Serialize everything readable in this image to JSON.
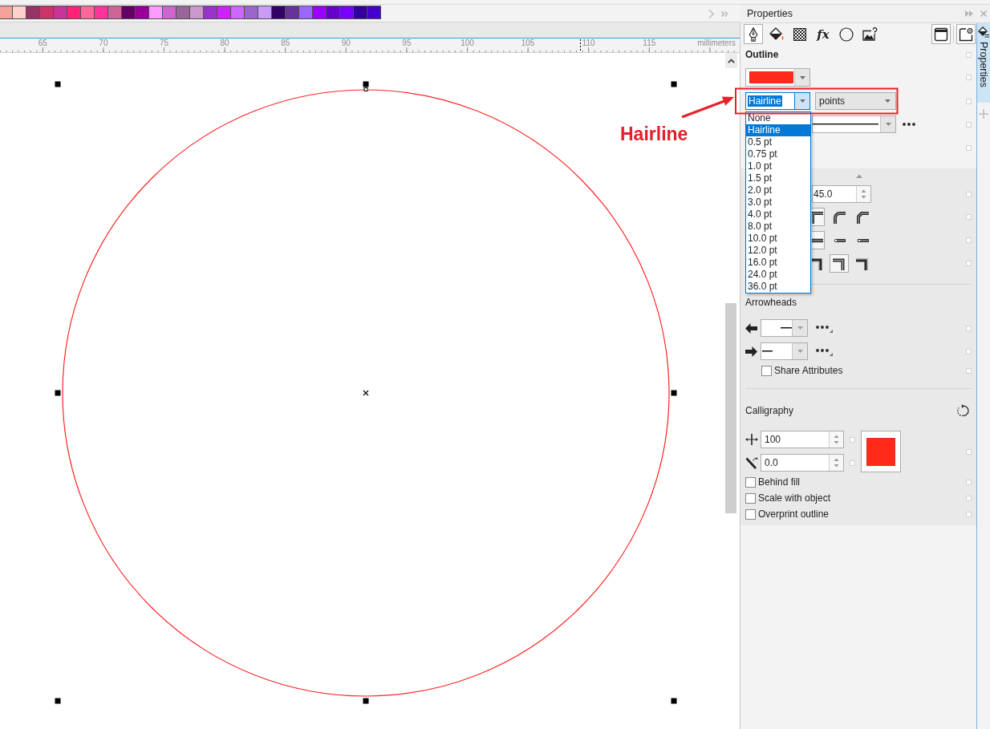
{
  "palette": {
    "swatches": [
      {
        "color": "#f4a19b"
      },
      {
        "color": "#ffd1cd"
      },
      {
        "color": "#993366"
      },
      {
        "color": "#cc3366"
      },
      {
        "color": "#cc3399"
      },
      {
        "color": "#ff2277"
      },
      {
        "color": "#ff6699"
      },
      {
        "color": "#ff3399"
      },
      {
        "color": "#cc6699"
      },
      {
        "color": "#660066"
      },
      {
        "color": "#990099"
      },
      {
        "color": "#ff99ff"
      },
      {
        "color": "#cc66cc"
      },
      {
        "color": "#996699"
      },
      {
        "color": "#cc99cc"
      },
      {
        "color": "#9933cc"
      },
      {
        "color": "#cc22ff"
      },
      {
        "color": "#cc66ff"
      },
      {
        "color": "#9966cc"
      },
      {
        "color": "#cc99ff"
      },
      {
        "color": "#330066"
      },
      {
        "color": "#663399"
      },
      {
        "color": "#9966ff"
      },
      {
        "color": "#9900ff"
      },
      {
        "color": "#6600cc"
      },
      {
        "color": "#7700ff"
      },
      {
        "color": "#330099"
      },
      {
        "color": "#4400cc"
      }
    ]
  },
  "ruler": {
    "labels": [
      "65",
      "70",
      "75",
      "80",
      "85",
      "90",
      "95",
      "100",
      "105",
      "110",
      "115"
    ],
    "unit": "millimeters"
  },
  "canvas": {
    "objects": [
      {
        "kind": "ellipse",
        "selected": true
      }
    ]
  },
  "annotation": {
    "label": "Hairline"
  },
  "panel": {
    "title": "Properties",
    "tabs": [
      {
        "kind": "outline",
        "selected": true
      },
      {
        "kind": "fill",
        "selected": false
      },
      {
        "kind": "transparency",
        "selected": false
      },
      {
        "kind": "effects",
        "glyph": "fx",
        "selected": false
      },
      {
        "kind": "object",
        "selected": false
      },
      {
        "kind": "bitmap",
        "selected": false
      }
    ],
    "outline": {
      "heading": "Outline",
      "width": {
        "value": "Hairline",
        "expanded": true,
        "options": [
          {
            "label": "None",
            "selected": false
          },
          {
            "label": "Hairline",
            "selected": true
          },
          {
            "label": "0.5 pt",
            "selected": false
          },
          {
            "label": "0.75 pt",
            "selected": false
          },
          {
            "label": "1.0 pt",
            "selected": false
          },
          {
            "label": "1.5 pt",
            "selected": false
          },
          {
            "label": "2.0 pt",
            "selected": false
          },
          {
            "label": "3.0 pt",
            "selected": false
          },
          {
            "label": "4.0 pt",
            "selected": false
          },
          {
            "label": "8.0 pt",
            "selected": false
          },
          {
            "label": "10.0 pt",
            "selected": false
          },
          {
            "label": "12.0 pt",
            "selected": false
          },
          {
            "label": "16.0 pt",
            "selected": false
          },
          {
            "label": "24.0 pt",
            "selected": false
          },
          {
            "label": "36.0 pt",
            "selected": false
          }
        ]
      },
      "units": "points",
      "miter_limit": "45.0",
      "corners": [
        {
          "selected": true
        },
        {
          "selected": false
        },
        {
          "selected": false
        }
      ],
      "line_caps": [
        {
          "selected": true
        },
        {
          "selected": false
        },
        {
          "selected": false
        }
      ],
      "position": [
        {
          "selected": false
        },
        {
          "selected": true
        },
        {
          "selected": false
        }
      ]
    },
    "arrowheads": {
      "heading": "Arrowheads",
      "share_attributes": {
        "label": "Share Attributes",
        "checked": false
      }
    },
    "calligraphy": {
      "heading": "Calligraphy",
      "stretch": "100",
      "angle": "0.0",
      "options": [
        {
          "label": "Behind fill",
          "checked": false
        },
        {
          "label": "Scale with object",
          "checked": false
        },
        {
          "label": "Overprint outline",
          "checked": false
        }
      ]
    }
  },
  "dock_tab": {
    "label": "Properties",
    "selected": true
  }
}
